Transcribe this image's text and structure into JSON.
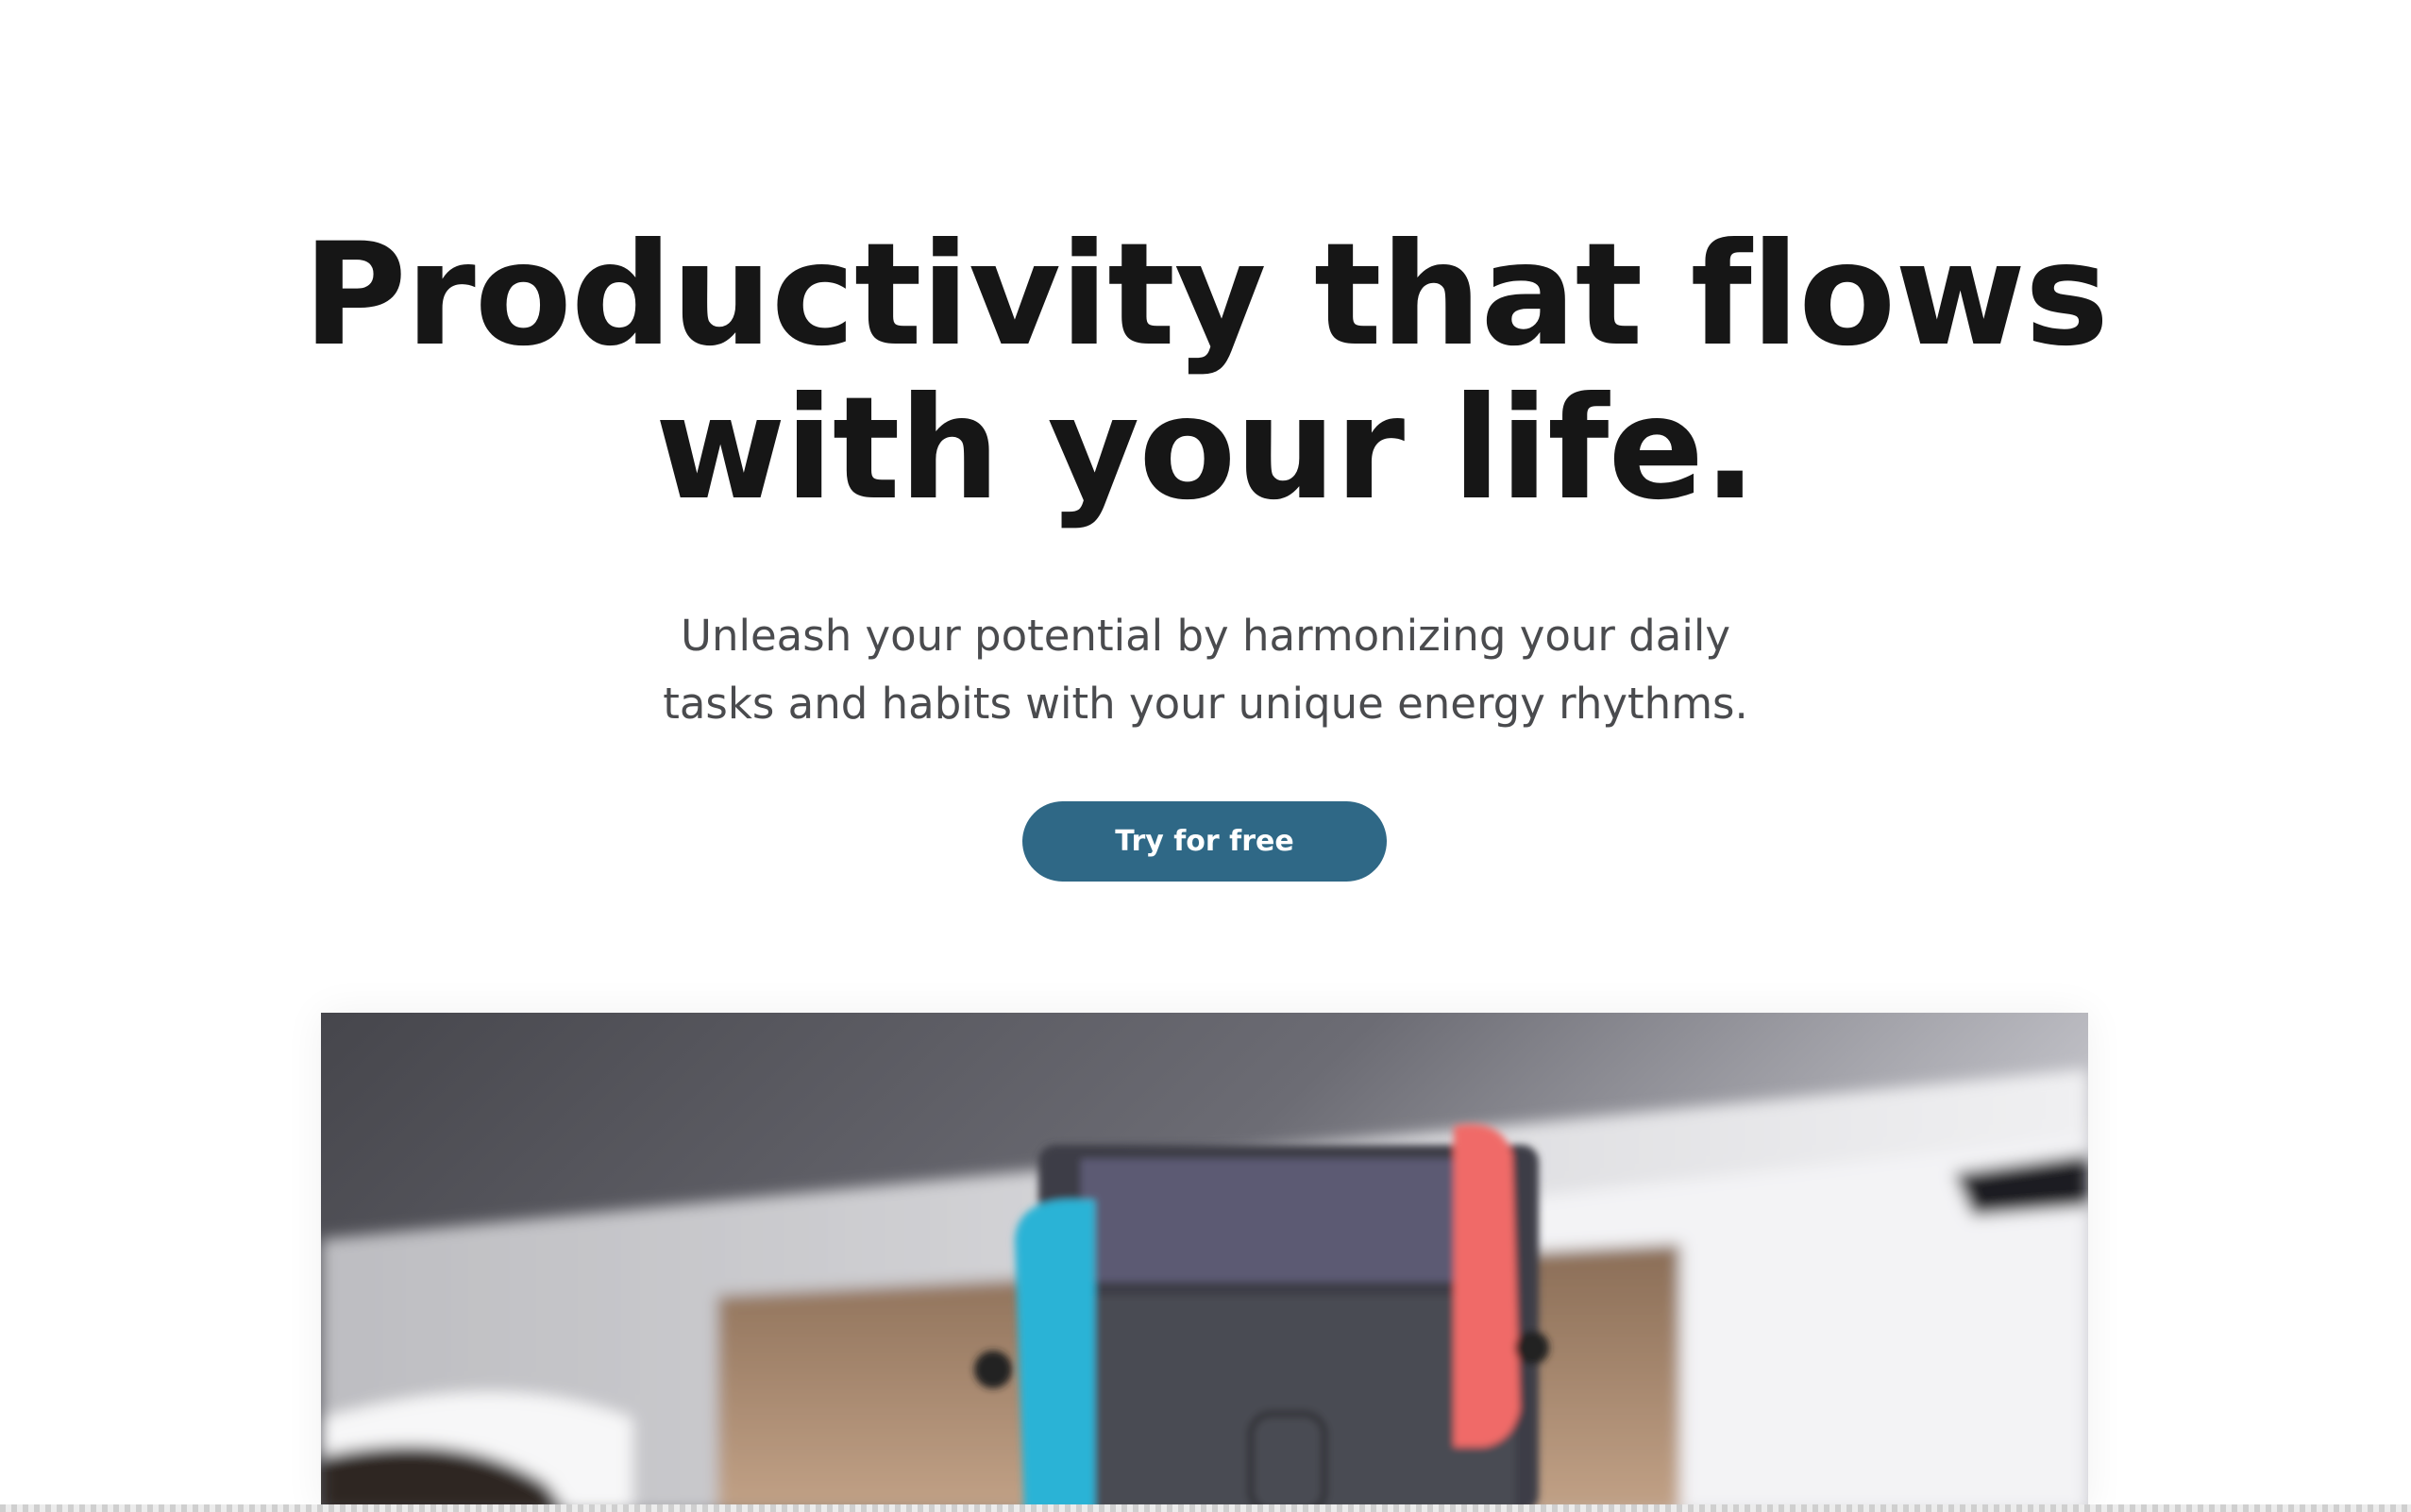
{
  "hero": {
    "headline_line1": "Productivity that flows",
    "headline_line2": "with your life.",
    "subtitle_line1": "Unleash your potential by harmonizing your daily",
    "subtitle_line2": "tasks and habits with your unique energy rhythms.",
    "cta_label": "Try for free"
  },
  "colors": {
    "headline": "#161616",
    "subtitle": "#4a4b4e",
    "cta_background": "#2f6886",
    "cta_text": "#ffffff"
  }
}
